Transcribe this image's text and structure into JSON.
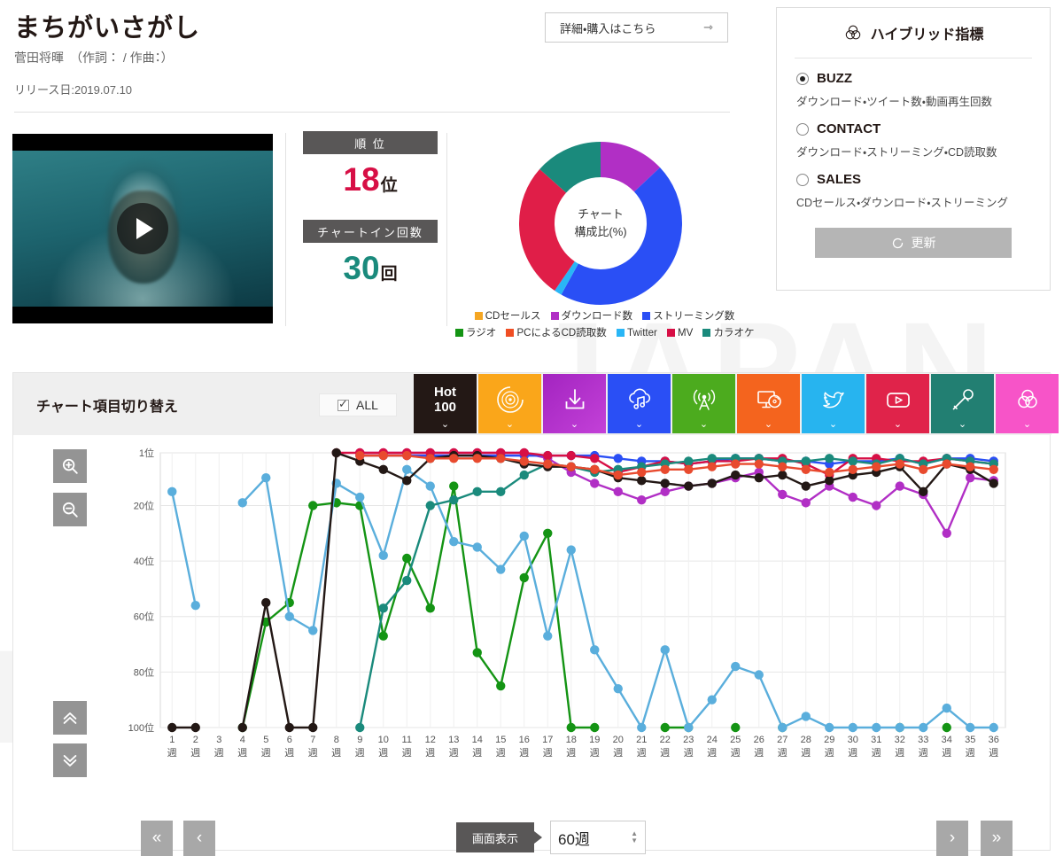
{
  "header": {
    "title": "まちがいさがし",
    "artist": "菅田将暉　（作詞： / 作曲：）",
    "release": "リリース日:2019.07.10",
    "buy_label": "詳細・購入はこちら",
    "buy_arrow": "⇾"
  },
  "media": {
    "play_icon": "play-icon"
  },
  "rank": {
    "rank_head": "順 位",
    "rank_num": "18",
    "rank_unit": "位",
    "chartin_head": "チャートイン回数",
    "chartin_num": "30",
    "chartin_unit": "回"
  },
  "donut": {
    "center_line1": "チャート",
    "center_line2": "構成比(%)",
    "legend_row1": [
      {
        "label": "CDセールス",
        "color": "#f5a623"
      },
      {
        "label": "ダウンロード数",
        "color": "#b12fc5"
      },
      {
        "label": "ストリーミング数",
        "color": "#2a4ff5"
      }
    ],
    "legend_row2": [
      {
        "label": "ラジオ",
        "color": "#149414"
      },
      {
        "label": "PCによるCD読取数",
        "color": "#f04e23"
      },
      {
        "label": "Twitter",
        "color": "#29b6f6"
      },
      {
        "label": "MV",
        "color": "#d70f45"
      },
      {
        "label": "カラオケ",
        "color": "#1a8a7c"
      }
    ]
  },
  "hybrid": {
    "title": "ハイブリッド指標",
    "icon": "venn-icon",
    "options": [
      {
        "label": "BUZZ",
        "desc": "ダウンロード・ツイート数・動画再生回数",
        "selected": true
      },
      {
        "label": "CONTACT",
        "desc": "ダウンロード・ストリーミング・CD読取数",
        "selected": false
      },
      {
        "label": "SALES",
        "desc": "CDセールス・ダウンロード・ストリーミング",
        "selected": false
      }
    ],
    "update_label": "更新",
    "update_icon": "refresh-icon"
  },
  "chart_panel": {
    "switch_title": "チャート項目切り替え",
    "all_label": "ALL",
    "tabs": [
      {
        "name": "hot100",
        "label": "Hot\n100",
        "icon": "hot100-text",
        "color": "#231815"
      },
      {
        "name": "cd-sales",
        "label": "",
        "icon": "vinyl-record-icon",
        "color": "#faa61a"
      },
      {
        "name": "download",
        "label": "",
        "icon": "download-arrow-icon",
        "color": "#b12fc5"
      },
      {
        "name": "streaming",
        "label": "",
        "icon": "cloud-music-icon",
        "color": "#2a4ff5"
      },
      {
        "name": "radio",
        "label": "",
        "icon": "radio-tower-icon",
        "color": "#4cab1e"
      },
      {
        "name": "pc-cd-read",
        "label": "",
        "icon": "pc-disc-icon",
        "color": "#f4641e"
      },
      {
        "name": "twitter",
        "label": "",
        "icon": "twitter-bird-icon",
        "color": "#27b4ef"
      },
      {
        "name": "mv",
        "label": "",
        "icon": "youtube-play-icon",
        "color": "#e0234a"
      },
      {
        "name": "karaoke",
        "label": "",
        "icon": "microphone-icon",
        "color": "#227f72"
      },
      {
        "name": "hybrid",
        "label": "",
        "icon": "venn-icon",
        "color": "#f754c8"
      }
    ],
    "zoom_in_icon": "zoom-in-icon",
    "zoom_out_icon": "zoom-out-icon",
    "scroll_up_icon": "double-chevron-up-icon",
    "scroll_down_icon": "double-chevron-down-icon",
    "first_page": "«",
    "prev_page": "‹",
    "next_page": "›",
    "last_page": "»",
    "display_label": "画面表示",
    "display_value": "60週"
  },
  "chart_data": {
    "type": "line",
    "title": "",
    "xlabel": "",
    "ylabel": "",
    "ylim": [
      1,
      100
    ],
    "y_inverted": true,
    "yticks": [
      1,
      20,
      40,
      60,
      80,
      100
    ],
    "ytick_labels": [
      "1位",
      "20位",
      "40位",
      "60位",
      "80位",
      "100位"
    ],
    "grid": true,
    "legend_position": "above-plot",
    "x": [
      "1週",
      "2週",
      "3週",
      "4週",
      "5週",
      "6週",
      "7週",
      "8週",
      "9週",
      "10週",
      "11週",
      "12週",
      "13週",
      "14週",
      "15週",
      "16週",
      "17週",
      "18週",
      "19週",
      "20週",
      "21週",
      "22週",
      "23週",
      "24週",
      "25週",
      "26週",
      "27週",
      "28週",
      "29週",
      "30週",
      "31週",
      "32週",
      "33週",
      "34週",
      "35週",
      "36週"
    ],
    "series": [
      {
        "name": "ダウンロード数",
        "color": "#b12fc5",
        "values": [
          null,
          null,
          null,
          null,
          null,
          null,
          null,
          null,
          1,
          1,
          1,
          1,
          1,
          1,
          1,
          1,
          3,
          8,
          12,
          15,
          18,
          15,
          13,
          12,
          10,
          8,
          16,
          19,
          13,
          17,
          20,
          13,
          16,
          30,
          10,
          11
        ]
      },
      {
        "name": "ストリーミング数",
        "color": "#2a4ff5",
        "values": [
          null,
          null,
          null,
          null,
          null,
          null,
          null,
          null,
          2,
          2,
          2,
          2,
          2,
          2,
          2,
          2,
          2,
          2,
          2,
          3,
          4,
          4,
          5,
          4,
          3,
          3,
          4,
          4,
          5,
          4,
          4,
          3,
          5,
          3,
          3,
          4
        ]
      },
      {
        "name": "ラジオ",
        "color": "#149414",
        "values": [
          null,
          null,
          null,
          100,
          62,
          55,
          20,
          19,
          20,
          67,
          39,
          57,
          13,
          73,
          85,
          46,
          30,
          100,
          100,
          null,
          null,
          100,
          100,
          null,
          100,
          null,
          100,
          null,
          null,
          null,
          null,
          100,
          null,
          100,
          null,
          null
        ]
      },
      {
        "name": "Twitter",
        "color": "#5aaedc",
        "values": [
          15,
          56,
          null,
          19,
          10,
          60,
          65,
          12,
          17,
          38,
          7,
          13,
          33,
          35,
          43,
          31,
          67,
          36,
          72,
          86,
          100,
          72,
          100,
          90,
          78,
          81,
          100,
          96,
          100,
          100,
          100,
          100,
          100,
          93,
          100,
          100
        ]
      },
      {
        "name": "MV",
        "color": "#d70f45",
        "values": [
          null,
          null,
          null,
          null,
          null,
          null,
          null,
          1,
          1,
          1,
          1,
          1,
          1,
          1,
          1,
          1,
          2,
          2,
          3,
          8,
          6,
          4,
          5,
          4,
          4,
          3,
          3,
          5,
          9,
          3,
          3,
          4,
          4,
          3,
          4,
          5
        ]
      },
      {
        "name": "カラオケ",
        "color": "#1a8a7c",
        "values": [
          null,
          null,
          null,
          null,
          null,
          null,
          null,
          null,
          100,
          57,
          47,
          20,
          18,
          15,
          15,
          9,
          5,
          6,
          8,
          7,
          6,
          5,
          4,
          3,
          3,
          3,
          4,
          4,
          3,
          4,
          5,
          3,
          5,
          3,
          4,
          5
        ]
      },
      {
        "name": "Hot 100",
        "color": "#231815",
        "values": [
          100,
          100,
          null,
          100,
          55,
          100,
          100,
          1,
          4,
          7,
          11,
          3,
          2,
          2,
          3,
          5,
          6,
          6,
          7,
          10,
          11,
          12,
          13,
          12,
          9,
          10,
          9,
          13,
          11,
          9,
          8,
          6,
          15,
          5,
          7,
          12
        ]
      },
      {
        "name": "PCによるCD読取数",
        "color": "#e84a2e",
        "values": [
          null,
          null,
          null,
          null,
          null,
          null,
          null,
          null,
          2,
          2,
          2,
          3,
          3,
          3,
          3,
          4,
          5,
          6,
          7,
          9,
          8,
          7,
          7,
          6,
          5,
          5,
          6,
          7,
          8,
          7,
          6,
          5,
          7,
          5,
          6,
          7
        ]
      }
    ]
  }
}
